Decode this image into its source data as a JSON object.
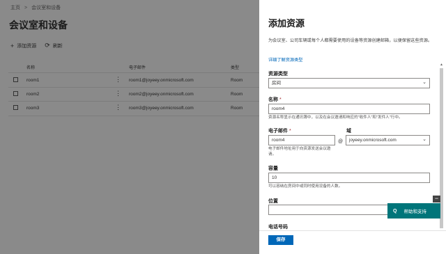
{
  "breadcrumb": {
    "home": "主页",
    "separator": ">",
    "current": "会议室和设备"
  },
  "page": {
    "title": "会议室和设备"
  },
  "toolbar": {
    "add_label": "添加资源",
    "add_icon": "plus-icon",
    "refresh_label": "刷新",
    "refresh_icon": "refresh-icon"
  },
  "list": {
    "columns": {
      "name": "名称",
      "email": "电子邮件",
      "type": "类型"
    },
    "rows": [
      {
        "name": "room1",
        "email": "room1@joyeey.onmicrosoft.com",
        "type": "Room"
      },
      {
        "name": "room2",
        "email": "room2@joyeey.onmicrosoft.com",
        "type": "Room"
      },
      {
        "name": "room3",
        "email": "room3@joyeey.onmicrosoft.com",
        "type": "Room"
      }
    ]
  },
  "panel": {
    "title": "添加资源",
    "description": "为会议室、公司车辆或每个人都需要使用的设备等资源创建邮箱，以便保留这些资源。",
    "link": "详细了解资源类型",
    "resource_type": {
      "label": "资源类型",
      "value": "房间"
    },
    "name": {
      "label": "名称",
      "value": "room4",
      "hint": "资源名称显示在通讯簿中，以及在会议邀请和响应的\"收件人\"和\"发件人\"行中。"
    },
    "email": {
      "label": "电子邮件",
      "value": "room4",
      "hint": "电子邮件地址用于向资源发送会议邀请。"
    },
    "at_sign": "@",
    "domain": {
      "label": "域",
      "value": "joyeey.onmicrosoft.com"
    },
    "capacity": {
      "label": "容量",
      "value": "10",
      "hint": "可以容纳在房间中或同时使用设备的人数。"
    },
    "location": {
      "label": "位置",
      "value": ""
    },
    "phone": {
      "label": "电话号码"
    },
    "required_mark": "*",
    "save_label": "保存"
  },
  "help": {
    "label": "帮助和支持",
    "icon_text": "Q",
    "minimize": "−"
  },
  "colors": {
    "accent": "#0067b8",
    "help_bg": "#00757a",
    "overlay": "#8a8a8a"
  }
}
